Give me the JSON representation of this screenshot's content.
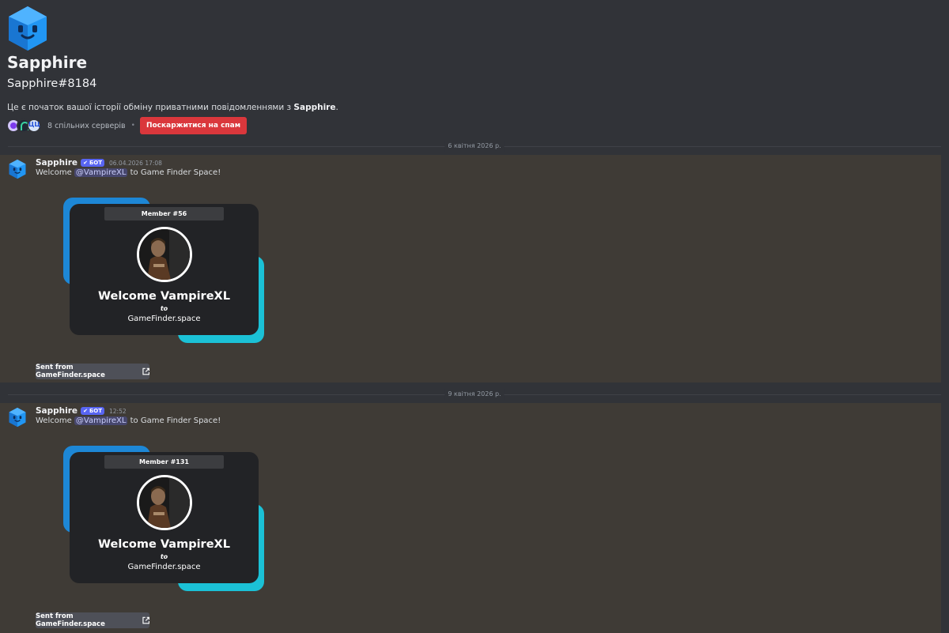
{
  "profile": {
    "name": "Sapphire",
    "tag": "Sapphire#8184",
    "intro_prefix": "Це є початок вашої історії обміну приватними повідомленнями з ",
    "intro_name": "Sapphire",
    "intro_suffix": ".",
    "mutual_servers": "8 спільних серверів",
    "separator": "•",
    "report_label": "Поскаржитися на спам"
  },
  "messages": [
    {
      "date_divider": "6 квітня 2026 р.",
      "author": "Sapphire",
      "badge": "БОТ",
      "badge_check": "✔",
      "timestamp": "06.04.2026 17:08",
      "text_before": "Welcome ",
      "mention": "@VampireXL",
      "text_after": " to Game Finder Space!",
      "card": {
        "member": "Member #56",
        "welcome": "Welcome VampireXL",
        "to": "to",
        "site": "GameFinder.space"
      },
      "link_label": "Sent from GameFinder.space"
    },
    {
      "date_divider": "9 квітня 2026 р.",
      "author": "Sapphire",
      "badge": "БОТ",
      "badge_check": "✔",
      "timestamp": "12:52",
      "text_before": "Welcome ",
      "mention": "@VampireXL",
      "text_after": " to Game Finder Space!",
      "card": {
        "member": "Member #131",
        "welcome": "Welcome VampireXL",
        "to": "to",
        "site": "GameFinder.space"
      },
      "link_label": "Sent from GameFinder.space"
    }
  ],
  "colors": {
    "background": "#313338",
    "message_highlight": "#3f3b36",
    "report_button": "#da373c",
    "bot_badge": "#5865f2",
    "card_blue": "#1d87d6",
    "card_cyan": "#1bc1d6",
    "card_front": "#222326"
  },
  "icons": {
    "avatar": "sapphire-gem-avatar-icon",
    "external_link": "external-link-icon"
  }
}
